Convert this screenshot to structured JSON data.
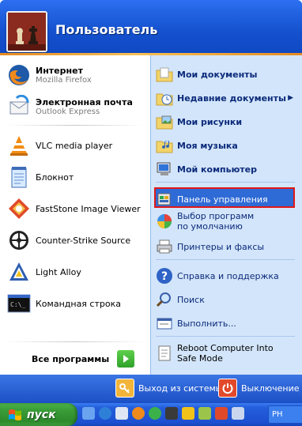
{
  "user": {
    "name": "Пользователь"
  },
  "left_pinned": [
    {
      "title": "Интернет",
      "subtitle": "Mozilla Firefox",
      "icon": "firefox-icon"
    },
    {
      "title": "Электронная почта",
      "subtitle": "Outlook Express",
      "icon": "outlook-express-icon"
    }
  ],
  "left_recent": [
    {
      "title": "VLC media player",
      "icon": "vlc-icon"
    },
    {
      "title": "Блокнот",
      "icon": "notepad-icon"
    },
    {
      "title": "FastStone Image Viewer",
      "icon": "faststone-icon"
    },
    {
      "title": "Counter-Strike Source",
      "icon": "counter-strike-icon"
    },
    {
      "title": "Light Alloy",
      "icon": "light-alloy-icon"
    },
    {
      "title": "Командная строка",
      "icon": "command-prompt-icon"
    }
  ],
  "all_programs": {
    "label": "Все программы"
  },
  "right_items": [
    {
      "label": "Мои документы",
      "icon": "my-documents-icon"
    },
    {
      "label": "Недавние документы",
      "icon": "recent-documents-icon"
    },
    {
      "label": "Мои рисунки",
      "icon": "my-pictures-icon"
    },
    {
      "label": "Моя музыка",
      "icon": "my-music-icon"
    },
    {
      "label": "Мой компьютер",
      "icon": "my-computer-icon"
    },
    {
      "label": "Панель управления",
      "icon": "control-panel-icon"
    },
    {
      "label": "Выбор программ по умолчанию",
      "icon": "default-programs-icon"
    },
    {
      "label": "Принтеры и факсы",
      "icon": "printers-icon"
    },
    {
      "label": "Справка и поддержка",
      "icon": "help-icon"
    },
    {
      "label": "Поиск",
      "icon": "search-icon"
    },
    {
      "label": "Выполнить...",
      "icon": "run-icon"
    },
    {
      "label": "Reboot Computer Into Safe Mode",
      "icon": "reboot-safe-mode-icon"
    }
  ],
  "footer": {
    "logoff": "Выход из системы",
    "shutdown": "Выключение"
  },
  "taskbar": {
    "start": "пуск",
    "button": "PH"
  },
  "colors": {
    "header": "#1f5fd8",
    "highlight_border": "#e01818",
    "right_panel": "#d3e5fa",
    "start_green": "#3a9d38"
  }
}
